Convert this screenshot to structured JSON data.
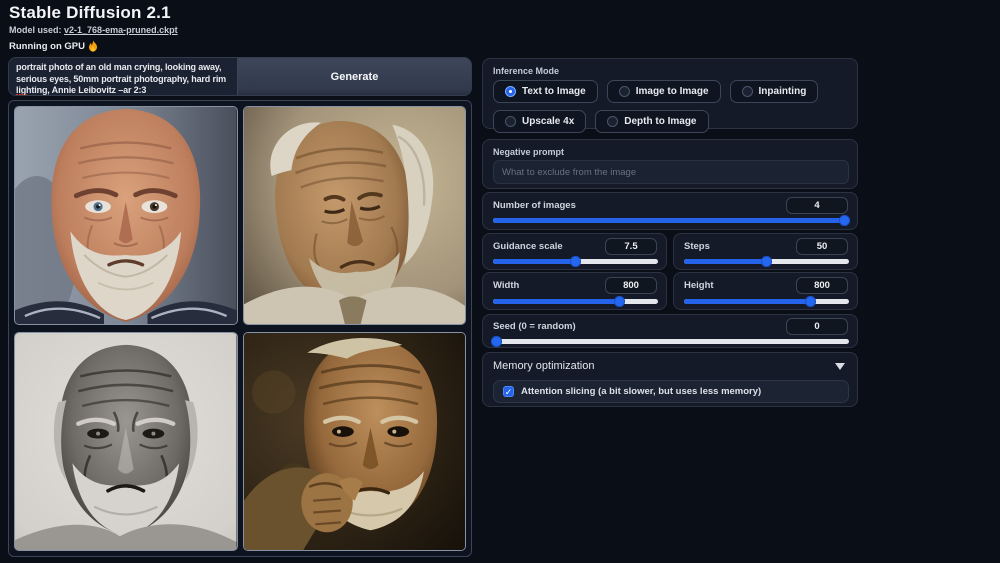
{
  "header": {
    "title": "Stable Diffusion 2.1",
    "model_label": "Model used:",
    "model_link": "v2-1_768-ema-pruned.ckpt",
    "running_on": "Running on GPU",
    "fire_icon": "flame"
  },
  "prompt": {
    "value": "portrait photo of an old man crying, looking away, serious eyes, 50mm portrait photography, hard rim lighting, Annie Leibovitz –ar 2:3",
    "generate_label": "Generate"
  },
  "gallery": {
    "images": [
      {
        "description": "color close-up portrait of an old man crying, white beard, dark striped shirt"
      },
      {
        "description": "sepia portrait of an old man with white hair looking down, tan background"
      },
      {
        "description": "black and white portrait of a frowning old man with white beard, light background"
      },
      {
        "description": "dark sepia portrait of an old man resting his fist under his chin"
      }
    ]
  },
  "inference_mode": {
    "label": "Inference Mode",
    "options": [
      {
        "label": "Text to Image",
        "selected": true
      },
      {
        "label": "Image to Image",
        "selected": false
      },
      {
        "label": "Inpainting",
        "selected": false
      },
      {
        "label": "Upscale 4x",
        "selected": false
      },
      {
        "label": "Depth to Image",
        "selected": false
      }
    ]
  },
  "negative_prompt": {
    "label": "Negative prompt",
    "placeholder": "What to exclude from the image",
    "value": ""
  },
  "sliders": {
    "num_images": {
      "label": "Number of images",
      "value": "4",
      "percent": 99
    },
    "guidance": {
      "label": "Guidance scale",
      "value": "7.5",
      "percent": 50
    },
    "steps": {
      "label": "Steps",
      "value": "50",
      "percent": 50
    },
    "width": {
      "label": "Width",
      "value": "800",
      "percent": 77
    },
    "height": {
      "label": "Height",
      "value": "800",
      "percent": 77
    },
    "seed": {
      "label": "Seed (0 = random)",
      "value": "0",
      "percent": 1
    }
  },
  "memory": {
    "label": "Memory optimization",
    "checkbox_label": "Attention slicing (a bit slower, but uses less memory)",
    "checked": true,
    "check_glyph": "✓"
  },
  "colors": {
    "accent": "#2563eb",
    "track": "#e3e6eb",
    "background": "#0a0e17",
    "panel": "#141a27"
  }
}
